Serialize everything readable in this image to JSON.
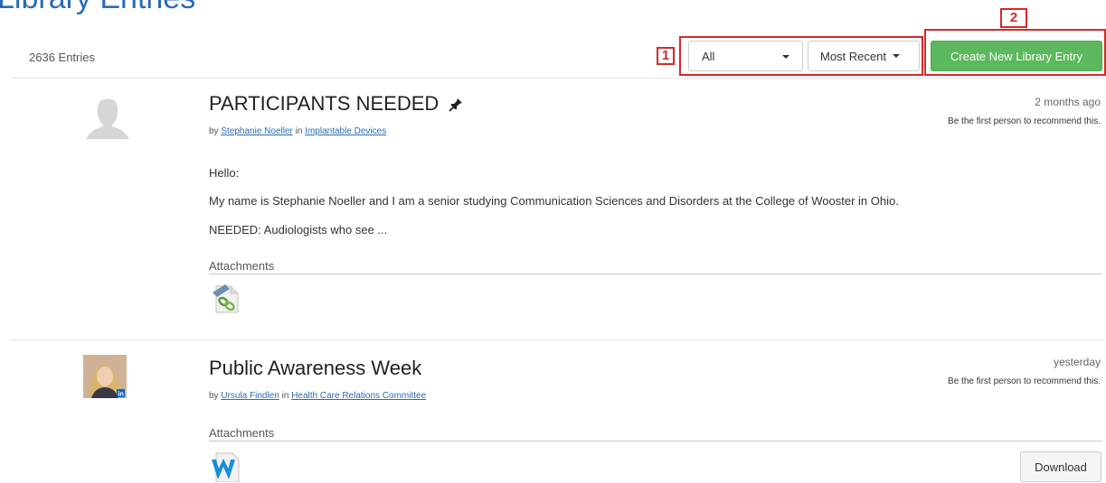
{
  "page": {
    "title": "Library Entries",
    "entry_count": "2636 Entries"
  },
  "toolbar": {
    "filter_value": "All",
    "sort_value": "Most Recent",
    "create_label": "Create New Library Entry"
  },
  "callouts": {
    "filters_number": "1",
    "create_number": "2",
    "color": "#d32a2a"
  },
  "entries": [
    {
      "title": "PARTICIPANTS NEEDED",
      "pinned_icon": "pin-icon",
      "by": "by",
      "author": "Stephanie Noeller",
      "in": "in",
      "community": "Implantable Devices",
      "timestamp": "2 months ago",
      "recommend": "Be the first person to recommend this.",
      "body": [
        "Hello:",
        "My name is Stephanie Noeller and I am a senior studying Communication Sciences and Disorders at the College of Wooster in Ohio.",
        "NEEDED: Audiologists who see ..."
      ],
      "attachments_label": "Attachments",
      "attachment_icon": "link-file-icon"
    },
    {
      "title": "Public Awareness Week",
      "by": "by",
      "author": "Ursula Findlen",
      "in": "in",
      "community": "Health Care Relations Committee",
      "timestamp": "yesterday",
      "recommend": "Be the first person to recommend this.",
      "attachments_label": "Attachments",
      "attachment_icon": "word-doc-icon",
      "download_label": "Download"
    }
  ],
  "colors": {
    "title_blue": "#2a6bb5",
    "create_green": "#5cb85c",
    "link_blue": "#2a6bb5"
  }
}
